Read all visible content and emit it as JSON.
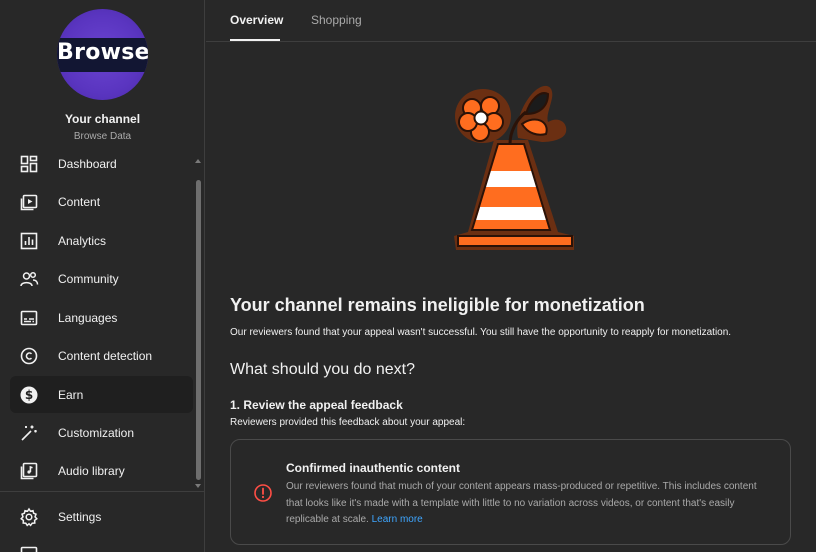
{
  "channel": {
    "avatar_text": "Browse",
    "title": "Your channel",
    "subtitle": "Browse Data"
  },
  "sidebar": {
    "items": [
      {
        "label": "Dashboard",
        "icon": "dashboard-icon"
      },
      {
        "label": "Content",
        "icon": "content-icon"
      },
      {
        "label": "Analytics",
        "icon": "analytics-icon"
      },
      {
        "label": "Community",
        "icon": "community-icon"
      },
      {
        "label": "Languages",
        "icon": "languages-icon"
      },
      {
        "label": "Content detection",
        "icon": "copyright-icon"
      },
      {
        "label": "Earn",
        "icon": "dollar-icon",
        "active": true
      },
      {
        "label": "Customization",
        "icon": "magic-wand-icon"
      },
      {
        "label": "Audio library",
        "icon": "audio-library-icon"
      }
    ],
    "settings_label": "Settings"
  },
  "tabs": [
    {
      "label": "Overview",
      "active": true
    },
    {
      "label": "Shopping",
      "active": false
    }
  ],
  "main": {
    "heading": "Your channel remains ineligible for monetization",
    "intro": "Our reviewers found that your appeal wasn't successful. You still have the opportunity to reapply for monetization.",
    "next_heading": "What should you do next?",
    "step1_title": "1. Review the appeal feedback",
    "step1_sub": "Reviewers provided this feedback about your appeal:",
    "card": {
      "title": "Confirmed inauthentic content",
      "body": "Our reviewers found that much of your content appears mass-produced or repetitive. This includes content that looks like it's made with a template with little to no variation across videos, or content that's easily replicable at scale.",
      "link": "Learn more"
    }
  },
  "colors": {
    "background": "#282828",
    "accent_link": "#3ea6ff",
    "alert_icon": "#ff4e45",
    "illustration_orange": "#ff6d1f",
    "illustration_outline": "#6b2f12"
  }
}
